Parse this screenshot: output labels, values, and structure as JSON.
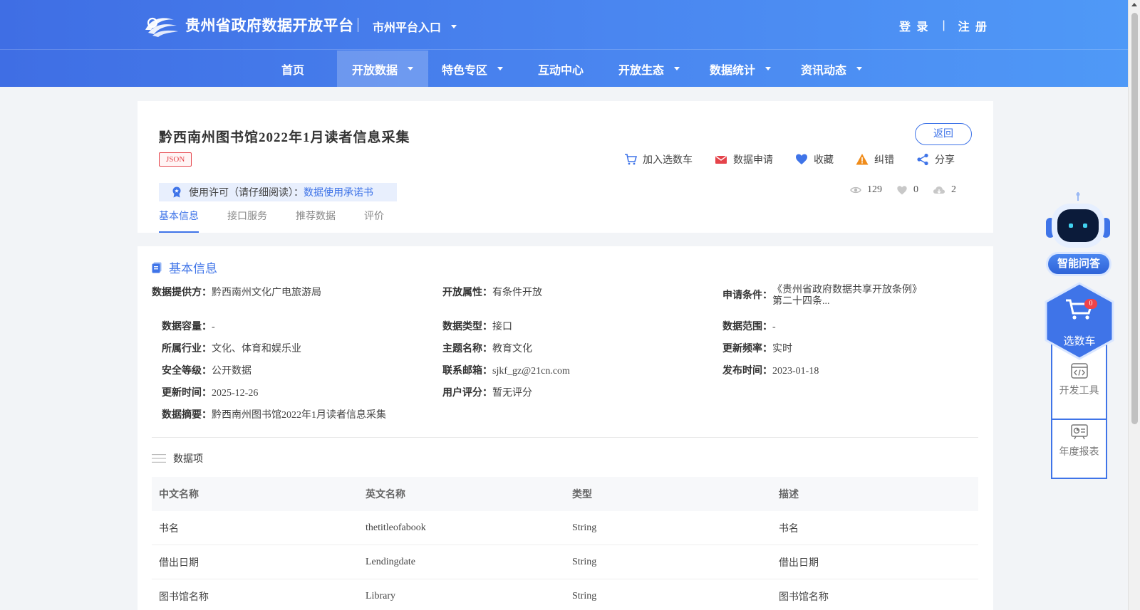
{
  "header": {
    "site_title": "贵州省政府数据开放平台",
    "city_entry": "市州平台入口",
    "login": "登 录",
    "auth_sep": "|",
    "register": "注 册"
  },
  "nav": {
    "home": "首页",
    "open_data": "开放数据",
    "feature_zone": "特色专区",
    "interaction": "互动中心",
    "ecology": "开放生态",
    "statistics": "数据统计",
    "news": "资讯动态"
  },
  "dataset": {
    "title": "黔西南州图书馆2022年1月读者信息采集",
    "format_tag": "JSON",
    "back": "返回",
    "actions": {
      "add_cart": "加入选数车",
      "apply": "数据申请",
      "favorite": "收藏",
      "report_error": "纠错",
      "share": "分享"
    },
    "license_label": "使用许可（请仔细阅读）：",
    "license_link": "数据使用承诺书",
    "stats": {
      "views": "129",
      "likes": "0",
      "downloads": "2"
    },
    "tabs": {
      "basic": "基本信息",
      "api": "接口服务",
      "recommend": "推荐数据",
      "rating": "评价"
    }
  },
  "basic_info": {
    "section_title": "基本信息",
    "provider_label": "数据提供方：",
    "provider": "黔西南州文化广电旅游局",
    "open_attr_label": "开放属性：",
    "open_attr": "有条件开放",
    "apply_cond_label": "申请条件：",
    "apply_cond": "《贵州省政府数据共享开放条例》第二十四条...",
    "capacity_label": "数据容量：",
    "capacity": "-",
    "type_label": "数据类型：",
    "type": "接口",
    "range_label": "数据范围：",
    "range": "-",
    "industry_label": "所属行业：",
    "industry": "文化、体育和娱乐业",
    "topic_label": "主题名称：",
    "topic": "教育文化",
    "freq_label": "更新频率：",
    "freq": "实时",
    "security_label": "安全等级：",
    "security": "公开数据",
    "email_label": "联系邮箱：",
    "email": "sjkf_gz@21cn.com",
    "publish_label": "发布时间：",
    "publish": "2023-01-18",
    "updated_label": "更新时间：",
    "updated": "2025-12-26",
    "score_label": "用户评分：",
    "score": "暂无评分",
    "summary_label": "数据摘要：",
    "summary": "黔西南州图书馆2022年1月读者信息采集"
  },
  "data_items": {
    "title": "数据项",
    "columns": [
      "中文名称",
      "英文名称",
      "类型",
      "描述"
    ],
    "rows": [
      [
        "书名",
        "thetitleofabook",
        "String",
        "书名"
      ],
      [
        "借出日期",
        "Lendingdate",
        "String",
        "借出日期"
      ],
      [
        "图书馆名称",
        "Library",
        "String",
        "图书馆名称"
      ]
    ]
  },
  "float_panel": {
    "qa": "智能问答",
    "cart": "选数车",
    "cart_count": "0",
    "dev_tools": "开发工具",
    "annual_report": "年度报表"
  },
  "colors": {
    "primary": "#3f74e8",
    "header_start": "#3f6ee4",
    "header_end": "#4f99f7",
    "tag_red": "#e5434a"
  }
}
